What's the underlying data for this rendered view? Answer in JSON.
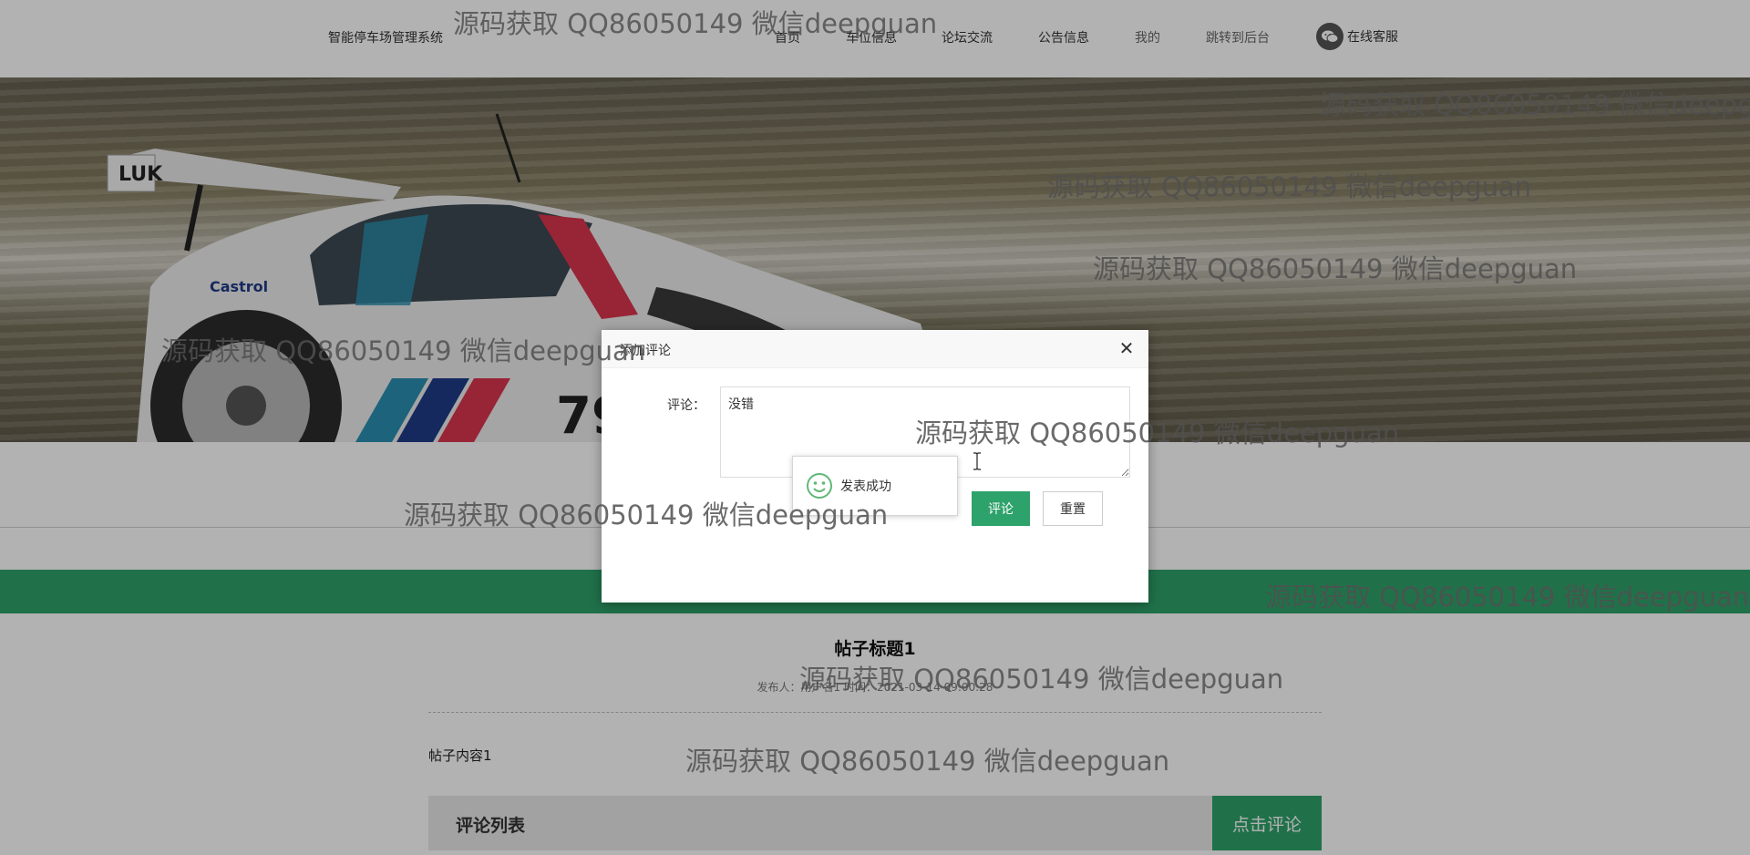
{
  "header": {
    "brand": "智能停车场管理系统",
    "nav": [
      {
        "label": "首页"
      },
      {
        "label": "车位信息"
      },
      {
        "label": "论坛交流"
      },
      {
        "label": "公告信息"
      },
      {
        "label": "我的"
      },
      {
        "label": "跳转到后台"
      }
    ],
    "service_label": "在线客服"
  },
  "post": {
    "title": "帖子标题1",
    "meta": "发布人：用户名1 时间：2021-03-14 09:00:28",
    "content": "帖子内容1"
  },
  "comments_section": {
    "title": "评论列表",
    "add_button": "点击评论"
  },
  "modal": {
    "title": "添加评论",
    "field_label": "评论：",
    "comment_value": "没错",
    "submit_label": "评论",
    "reset_label": "重置",
    "close_symbol": "✕"
  },
  "toast": {
    "message": "发表成功",
    "icon": "smile-icon"
  },
  "watermark_text": "源码获取 QQ86050149 微信deepguan",
  "colors": {
    "accent_green": "#2ea26b",
    "toast_icon": "#5fb878"
  }
}
